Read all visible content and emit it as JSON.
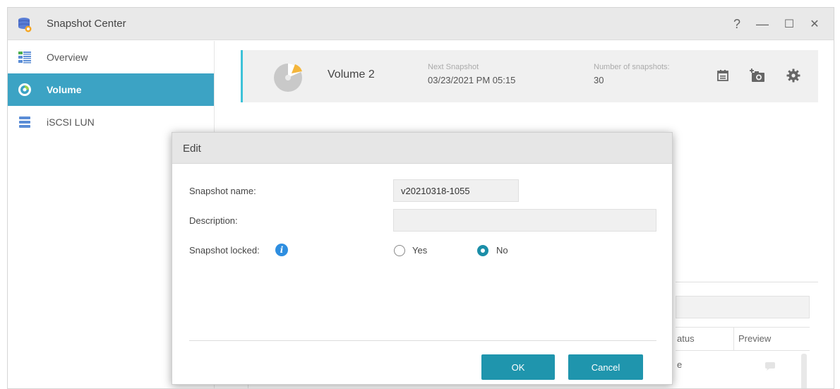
{
  "window": {
    "title": "Snapshot Center",
    "controls": {
      "help": "?",
      "minimize": "—",
      "maximize": "☐",
      "close": "✕"
    }
  },
  "sidebar": {
    "items": [
      {
        "label": "Overview",
        "icon": "overview-icon",
        "active": false
      },
      {
        "label": "Volume",
        "icon": "volume-icon",
        "active": true
      },
      {
        "label": "iSCSI LUN",
        "icon": "iscsi-lun-icon",
        "active": false
      }
    ]
  },
  "volume_card": {
    "name": "Volume 2",
    "next_snapshot_label": "Next Snapshot",
    "next_snapshot_value": "03/23/2021 PM 05:15",
    "count_label": "Number of snapshots:",
    "count_value": "30",
    "icons": [
      "calendar-icon",
      "take-snapshot-icon",
      "settings-gear-icon"
    ]
  },
  "background_table": {
    "status_header_partial": "atus",
    "preview_header": "Preview",
    "first_cell_partial": "e"
  },
  "dialog": {
    "title": "Edit",
    "snapshot_name_label": "Snapshot name:",
    "snapshot_name_value": "v20210318-1055",
    "description_label": "Description:",
    "description_value": "",
    "locked_label": "Snapshot locked:",
    "locked_options": [
      {
        "label": "Yes",
        "selected": false
      },
      {
        "label": "No",
        "selected": true
      }
    ],
    "ok_label": "OK",
    "cancel_label": "Cancel"
  },
  "colors": {
    "accent": "#1f95ad",
    "sidebar_active": "#3ca3c4",
    "card_stripe": "#3dc2d8"
  }
}
